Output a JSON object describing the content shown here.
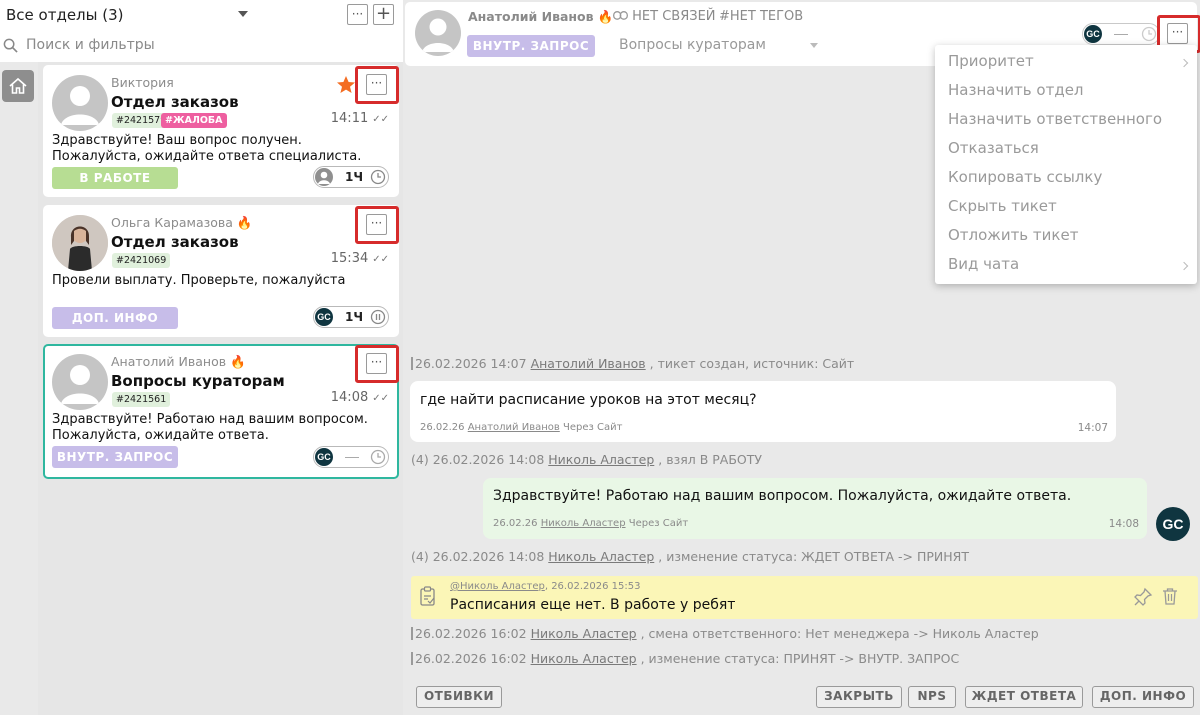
{
  "sidebar": {
    "department_selector": "Все отделы (3)",
    "more_icon": "more-dots-icon",
    "add_icon": "plus-icon",
    "search_placeholder": "Поиск и фильтры",
    "home_icon": "home-icon"
  },
  "tickets": [
    {
      "author": "Виктория",
      "title": "Отдел заказов",
      "id_tag": "#2421579",
      "extra_tag": "#ЖАЛОБА",
      "time": "14:11",
      "text": "Здравствуйте! Ваш вопрос получен. Пожалуйста, ожидайте ответа специалиста.",
      "status": "В РАБОТЕ",
      "assignee_value": "1Ч",
      "starred": true,
      "colors": {
        "status": "#b7dd93",
        "tag": "#ee5fa0"
      }
    },
    {
      "author": "Ольга Карамазова",
      "title": "Отдел заказов",
      "id_tag": "#2421069",
      "time": "15:34",
      "text": "Провели выплату. Проверьте, пожалуйста",
      "status": "ДОП. ИНФО",
      "assignee_initials": "GC",
      "assignee_value": "1Ч",
      "colors": {
        "status": "#c7bde9"
      }
    },
    {
      "author": "Анатолий Иванов",
      "title": "Вопросы кураторам",
      "id_tag": "#2421561",
      "time": "14:08",
      "text": "Здравствуйте! Работаю над вашим вопросом. Пожалуйста, ожидайте ответа.",
      "status": "ВНУТР. ЗАПРОС",
      "assignee_initials": "GC",
      "active": true,
      "colors": {
        "status": "#c7bde9",
        "active_border": "#2fb79f"
      }
    }
  ],
  "chat": {
    "header": {
      "name": "Анатолий Иванов",
      "links": "НЕТ СВЯЗЕЙ",
      "tags": "#НЕТ ТЕГОВ",
      "status": "ВНУТР. ЗАПРОС",
      "department": "Вопросы кураторам",
      "assignee_initials": "GC"
    },
    "menu": [
      {
        "label": "Приоритет",
        "submenu": true
      },
      {
        "label": "Назначить отдел"
      },
      {
        "label": "Назначить ответственного"
      },
      {
        "label": "Отказаться"
      },
      {
        "label": "Копировать ссылку"
      },
      {
        "label": "Скрыть тикет"
      },
      {
        "label": "Отложить тикет"
      },
      {
        "label": "Вид чата",
        "submenu": true
      }
    ],
    "events": {
      "created": {
        "date": "26.02.2026 14:07",
        "user": "Анатолий Иванов",
        "text": ", тикет создан, источник: Сайт"
      },
      "taken": {
        "prefix": "(4)",
        "date": "26.02.2026 14:08",
        "user": "Николь Аластер",
        "text": ", взял В РАБОТУ"
      },
      "status1": {
        "prefix": "(4)",
        "date": "26.02.2026 14:08",
        "user": "Николь Аластер",
        "text": ", изменение статуса: ЖДЕТ ОТВЕТА -> ПРИНЯТ"
      },
      "assignee": {
        "date": "26.02.2026 16:02",
        "user": "Николь Аластер",
        "text": ", смена ответственного: Нет менеджера -> Николь Аластер"
      },
      "status2": {
        "date": "26.02.2026 16:02",
        "user": "Николь Аластер",
        "text": ", изменение статуса: ПРИНЯТ -> ВНУТР. ЗАПРОС"
      }
    },
    "messages": {
      "incoming": {
        "text": "где найти расписание уроков на этот месяц?",
        "date": "26.02.26",
        "user": "Анатолий Иванов",
        "via": "Через Сайт",
        "time": "14:07"
      },
      "outgoing": {
        "text": "Здравствуйте! Работаю над вашим вопросом. Пожалуйста, ожидайте ответа.",
        "date": "26.02.26",
        "user": "Николь Аластер",
        "via": "Через Сайт",
        "time": "14:08",
        "avatar": "GC"
      },
      "note": {
        "author": "@Николь Аластер",
        "date": "26.02.2026 15:53",
        "text": "Расписания еще нет. В работе у ребят"
      }
    },
    "bottom_buttons": {
      "left": "ОТБИВКИ",
      "close": "ЗАКРЫТЬ",
      "nps": "NPS",
      "wait": "ЖДЕТ ОТВЕТА",
      "info": "ДОП. ИНФО"
    }
  },
  "colors": {
    "highlight": "#d62b2b",
    "brand_dark": "#0f3540",
    "status_purple": "#c7bde9",
    "status_green": "#b7dd93"
  }
}
